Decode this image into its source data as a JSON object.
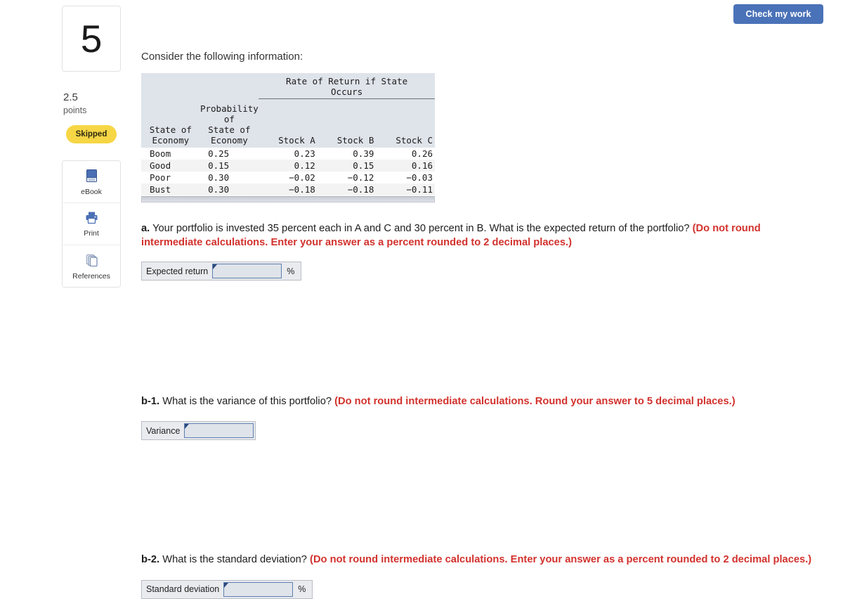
{
  "toolbar": {
    "check_my_work_label": "Check my work"
  },
  "sidebar": {
    "question_number": "5",
    "points_value": "2.5",
    "points_label": "points",
    "status_badge": "Skipped",
    "tools": [
      {
        "label": "eBook",
        "icon": "ebook-icon"
      },
      {
        "label": "Print",
        "icon": "print-icon"
      },
      {
        "label": "References",
        "icon": "references-icon"
      }
    ]
  },
  "main": {
    "intro": "Consider the following information:",
    "table": {
      "span_header": "Rate of Return if State\nOccurs",
      "columns": [
        "State of\nEconomy",
        "Probability of\nState of Economy",
        "Stock A",
        "Stock B",
        "Stock C"
      ],
      "rows": [
        {
          "state": "Boom",
          "probability": "0.25",
          "stock_a": "0.23",
          "stock_b": "0.39",
          "stock_c": "0.26"
        },
        {
          "state": "Good",
          "probability": "0.15",
          "stock_a": "0.12",
          "stock_b": "0.15",
          "stock_c": "0.16"
        },
        {
          "state": "Poor",
          "probability": "0.30",
          "stock_a": "−0.02",
          "stock_b": "−0.12",
          "stock_c": "−0.03"
        },
        {
          "state": "Bust",
          "probability": "0.30",
          "stock_a": "−0.18",
          "stock_b": "−0.18",
          "stock_c": "−0.11"
        }
      ]
    },
    "parts": [
      {
        "tag": "a.",
        "text": " Your portfolio is invested 35 percent each in A and C and 30 percent in B. What is the expected return of the portfolio? ",
        "hint": "(Do not round intermediate calculations. Enter your answer as a percent rounded to 2 decimal places.)",
        "answer_label": "Expected return",
        "answer_value": "",
        "answer_suffix": "%"
      },
      {
        "tag": "b-1.",
        "text": " What is the variance of this portfolio? ",
        "hint": "(Do not round intermediate calculations. Round your answer to 5 decimal places.)",
        "answer_label": "Variance",
        "answer_value": "",
        "answer_suffix": ""
      },
      {
        "tag": "b-2.",
        "text": " What is the standard deviation? ",
        "hint": "(Do not round intermediate calculations. Enter your answer as a percent rounded to 2 decimal places.)",
        "answer_label": "Standard deviation",
        "answer_value": "",
        "answer_suffix": "%"
      }
    ]
  },
  "colors": {
    "button_blue": "#4a72b8",
    "hint_red": "#d2322d",
    "badge_yellow": "#f6d645",
    "table_header_bg": "#dfe3ea",
    "input_border_blue": "#5d7fb0"
  }
}
